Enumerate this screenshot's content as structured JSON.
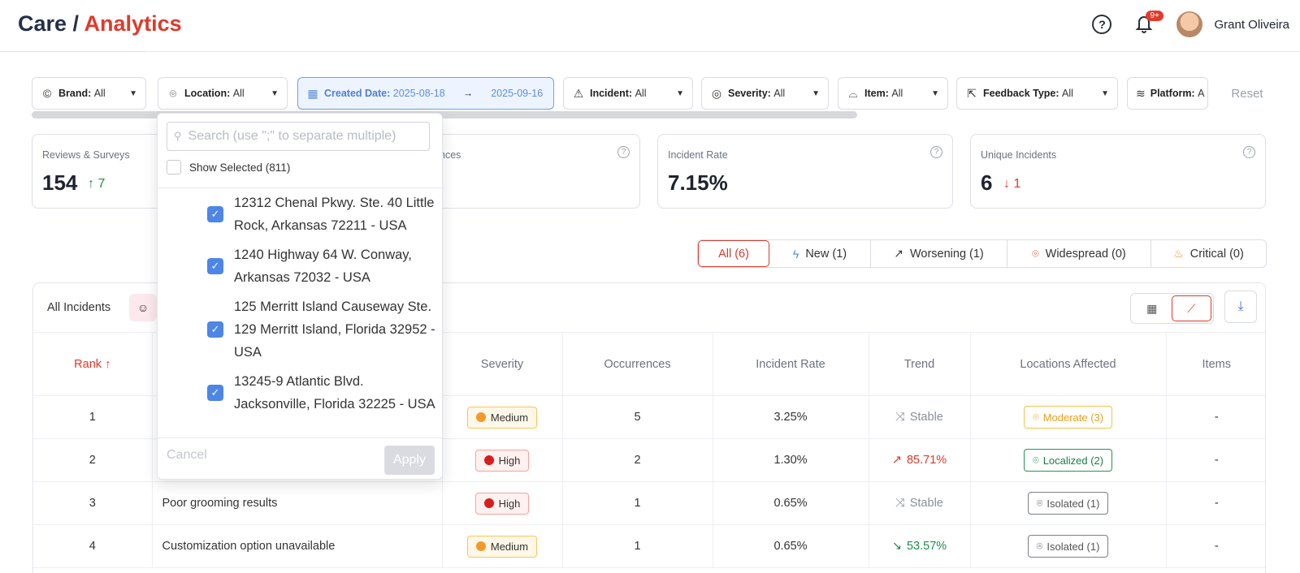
{
  "header": {
    "title_prefix": "Care / ",
    "title_accent": "Analytics",
    "notif_badge": "9+",
    "user_name": "Grant Oliveira"
  },
  "filters": {
    "brand": {
      "label": "Brand:",
      "value": "All"
    },
    "location": {
      "label": "Location:",
      "value": "All"
    },
    "created_date": {
      "label": "Created Date:",
      "from": "2025-08-18",
      "arrow": "→",
      "to": "2025-09-16"
    },
    "incident": {
      "label": "Incident:",
      "value": "All"
    },
    "severity": {
      "label": "Severity:",
      "value": "All"
    },
    "item": {
      "label": "Item:",
      "value": "All"
    },
    "feedback_type": {
      "label": "Feedback Type:",
      "value": "All"
    },
    "platform": {
      "label": "Platform:",
      "value": "A"
    },
    "reset_label": "Reset"
  },
  "cards": [
    {
      "label": "Reviews & Surveys",
      "value": "154",
      "delta": "7",
      "direction": "up"
    },
    {
      "label": "nces",
      "value": "",
      "delta": "",
      "direction": ""
    },
    {
      "label": "Incident Rate",
      "value": "7.15%",
      "delta": "",
      "direction": ""
    },
    {
      "label": "Unique Incidents",
      "value": "6",
      "delta": "1",
      "direction": "down"
    }
  ],
  "segments": [
    {
      "label": "All (6)",
      "icon": ""
    },
    {
      "label": "New (1)",
      "icon": "lightning-icon"
    },
    {
      "label": "Worsening (1)",
      "icon": "trend-up-icon"
    },
    {
      "label": "Widespread (0)",
      "icon": "map-pin-icon"
    },
    {
      "label": "Critical (0)",
      "icon": "fire-icon"
    }
  ],
  "panel": {
    "title": "All Incidents",
    "columns": [
      "Rank",
      "",
      "Severity",
      "Occurrences",
      "Incident Rate",
      "Trend",
      "Locations Affected",
      "Items"
    ],
    "rows": [
      {
        "rank": "1",
        "name": "",
        "severity": "Medium",
        "occurrences": "5",
        "rate": "3.25%",
        "trend": "Stable",
        "locations": "Moderate (3)",
        "items": "-"
      },
      {
        "rank": "2",
        "name": "",
        "severity": "High",
        "occurrences": "2",
        "rate": "1.30%",
        "trend": "85.71%",
        "locations": "Localized (2)",
        "items": "-"
      },
      {
        "rank": "3",
        "name": "Poor grooming results",
        "severity": "High",
        "occurrences": "1",
        "rate": "0.65%",
        "trend": "Stable",
        "locations": "Isolated (1)",
        "items": "-"
      },
      {
        "rank": "4",
        "name": "Customization option unavailable",
        "severity": "Medium",
        "occurrences": "1",
        "rate": "0.65%",
        "trend": "53.57%",
        "locations": "Isolated (1)",
        "items": "-"
      }
    ]
  },
  "dropdown": {
    "search_placeholder": "Search (use \";\" to separate multiple)",
    "show_selected": "Show Selected (811)",
    "items": [
      "12312 Chenal Pkwy. Ste. 40 Little Rock, Arkansas 72211 - USA",
      "1240 Highway 64 W. Conway, Arkansas 72032 - USA",
      "125 Merritt Island Causeway Ste. 129 Merritt Island, Florida 32952 - USA",
      "13245-9 Atlantic Blvd. Jacksonville, Florida 32225 - USA"
    ],
    "cancel": "Cancel",
    "apply": "Apply"
  },
  "colors": {
    "accent": "#dd3b2c",
    "primary_blue": "#4c86e6",
    "success": "#1f8b4c"
  }
}
